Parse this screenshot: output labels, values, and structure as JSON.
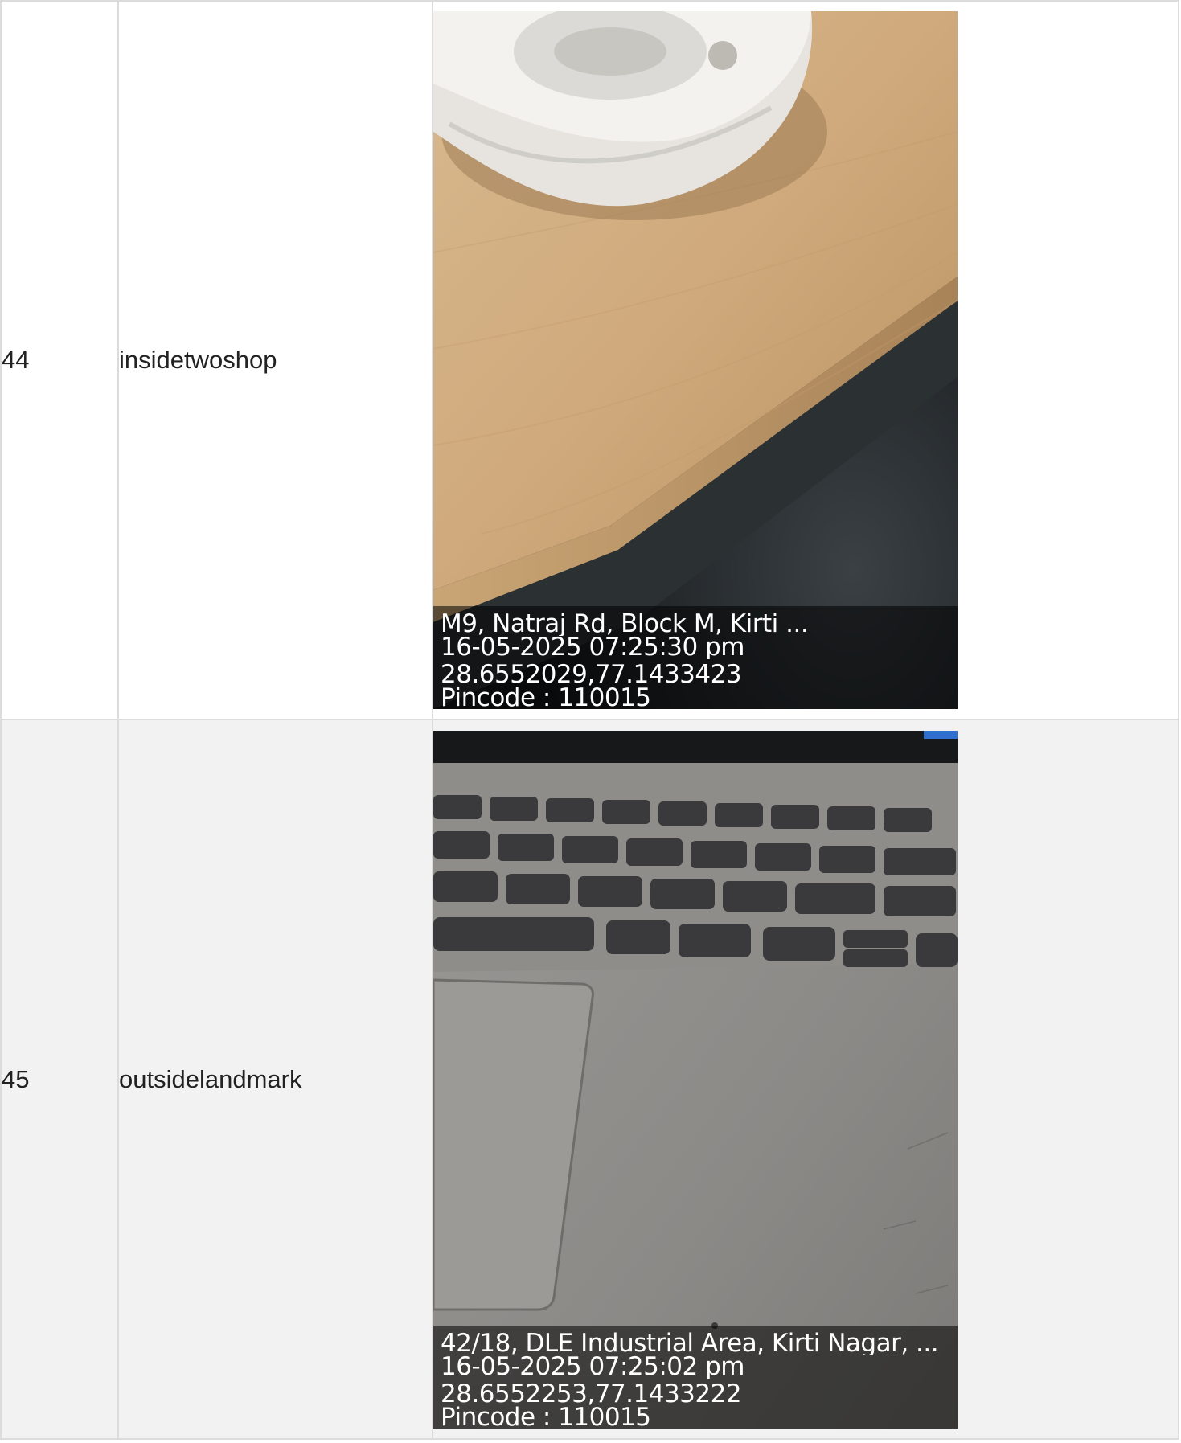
{
  "rows": [
    {
      "id": "44",
      "name": "insidetwoshop",
      "photo": {
        "address": "M9, Natraj Rd, Block M, Kirti ...",
        "datetime": "16-05-2025 07:25:30 pm",
        "coords": "28.6552029,77.1433423",
        "pincode": "Pincode : 110015"
      }
    },
    {
      "id": "45",
      "name": "outsidelandmark",
      "photo": {
        "address": "42/18, DLE Industrial Area, Kirti Nagar, ...",
        "datetime": "16-05-2025 07:25:02 pm",
        "coords": "28.6552253,77.1433222",
        "pincode": "Pincode : 110015"
      }
    }
  ]
}
